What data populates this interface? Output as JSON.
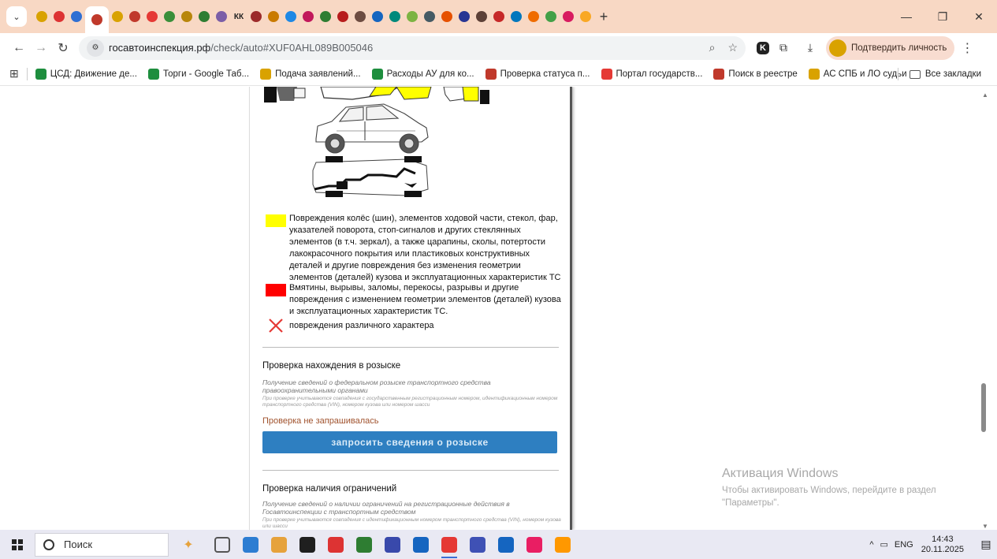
{
  "browser": {
    "tab_icon_colors": [
      "#d9a200",
      "#d33",
      "#2f6fd3",
      "#c0392b",
      "#d9a200",
      "#c0392b",
      "#e53935",
      "#3a8f3a",
      "#b8860b",
      "#2e7d32",
      "#7b5ea7",
      "#9c2a2a",
      "#c97a00",
      "#1e88e5",
      "#c2185b",
      "#2e7d32",
      "#b71c1c",
      "#6d4c41",
      "#1565c0",
      "#00897b",
      "#7cb342",
      "#455a64",
      "#e65100",
      "#283593",
      "#5d4037",
      "#c62828",
      "#0277bd",
      "#ef6c00",
      "#43a047",
      "#d81b60",
      "#f9a825"
    ],
    "tab_text_badge": "КК",
    "new_tab": "+",
    "window_controls": {
      "minimize": "—",
      "maximize": "❐",
      "close": "✕"
    },
    "url_host": "госавтоинспекция.рф",
    "url_path": "/check/auto#XUF0AHL089B005046",
    "verify_label": "Подтвердить личность",
    "bookmarks": [
      {
        "label": "ЦСД: Движение де...",
        "color": "#1e8e3e"
      },
      {
        "label": "Торги - Google Таб...",
        "color": "#1e8e3e"
      },
      {
        "label": "Подача заявлений...",
        "color": "#d9a200"
      },
      {
        "label": "Расходы АУ для ко...",
        "color": "#1e8e3e"
      },
      {
        "label": "Проверка статуса п...",
        "color": "#c0392b"
      },
      {
        "label": "Портал государств...",
        "color": "#e53935"
      },
      {
        "label": "Поиск в реестре",
        "color": "#c0392b"
      },
      {
        "label": "АС СПБ и ЛО судьи",
        "color": "#d9a200"
      }
    ],
    "all_bookmarks": "Все закладки"
  },
  "page": {
    "legend": {
      "yellow_color": "#ffff00",
      "red_color": "#ff0000",
      "yellow_text": "Повреждения колёс (шин), элементов ходовой части, стекол, фар, указателей поворота, стоп-сигналов и других стеклянных элементов (в т.ч. зеркал), а также царапины, сколы, потертости лакокрасочного покрытия или пластиковых конструктивных деталей и другие повреждения без изменения геометрии элементов (деталей) кузова и эксплуатационных характеристик ТС",
      "red_text": "Вмятины, вырывы, заломы, перекосы, разрывы и другие повреждения с изменением геометрии элементов (деталей) кузова и эксплуатационных характеристик ТС.",
      "x_text": "повреждения различного характера"
    },
    "wanted": {
      "title": "Проверка нахождения в розыске",
      "desc": "Получение сведений о федеральном розыске транспортного средства правоохранительными органами",
      "note": "При проверке учитываются совпадения с государственным регистрационным номером, идентификационным номером транспортного средства (VIN), номером кузова или номером шасси",
      "status": "Проверка не запрашивалась",
      "button": "запросить сведения о розыске"
    },
    "restrictions": {
      "title": "Проверка наличия ограничений",
      "desc": "Получение сведений о наличии ограничений на регистрационные действия в Госавтоинспекции с транспортным средством",
      "note": "При проверке учитываются совпадения с идентификационным номером транспортного средства (VIN), номером кузова или шасси"
    }
  },
  "activation": {
    "title": "Активация Windows",
    "line1": "Чтобы активировать Windows, перейдите в раздел",
    "line2": "\"Параметры\"."
  },
  "taskbar": {
    "search_placeholder": "Поиск",
    "lang": "ENG",
    "time": "14:43",
    "date": "20.11.2025",
    "app_colors": [
      "#555",
      "#2d7dd2",
      "#e6a23c",
      "#1f1f1f",
      "#d33",
      "#2e7d32",
      "#3949ab",
      "#1565c0",
      "#e53935",
      "#3f51b5",
      "#1565c0",
      "#e91e63",
      "#ff9800"
    ]
  }
}
